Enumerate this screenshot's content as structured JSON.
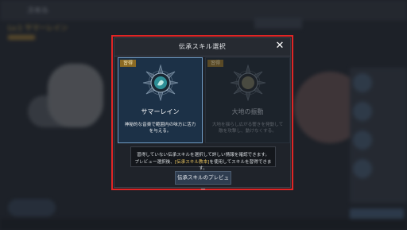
{
  "background": {
    "title": "スキル",
    "character_name": "Lv.1 サマーレイン"
  },
  "modal": {
    "title": "伝承スキル選択",
    "close_symbol": "✕",
    "cards": [
      {
        "badge": "習得",
        "name": "サマーレイン",
        "description": "神秘的な音楽で範囲内の味方に活力を与える。",
        "emblem_icon": "rain-emblem-icon",
        "state": "selected"
      },
      {
        "badge": "習得",
        "name": "大地の振動",
        "description": "大地を揺らし広がる響きを発動して敵を攻撃し、動けなくする。",
        "emblem_icon": "earth-emblem-icon",
        "state": "dimmed"
      }
    ],
    "info": {
      "line1": "習得していない伝承スキルを選択して詳しい情報を確認できます。",
      "line2_prefix": "プレビュー選択後、",
      "line2_highlight": "[伝承スキル教本]",
      "line2_suffix": "を使用してスキルを習得できます。"
    },
    "preview_button": "伝承スキルのプレビュー"
  },
  "colors": {
    "highlight_frame": "#e02525",
    "selected_card_border": "#6f9bc4",
    "badge": "#8b6a23",
    "info_highlight": "#e8c460"
  }
}
